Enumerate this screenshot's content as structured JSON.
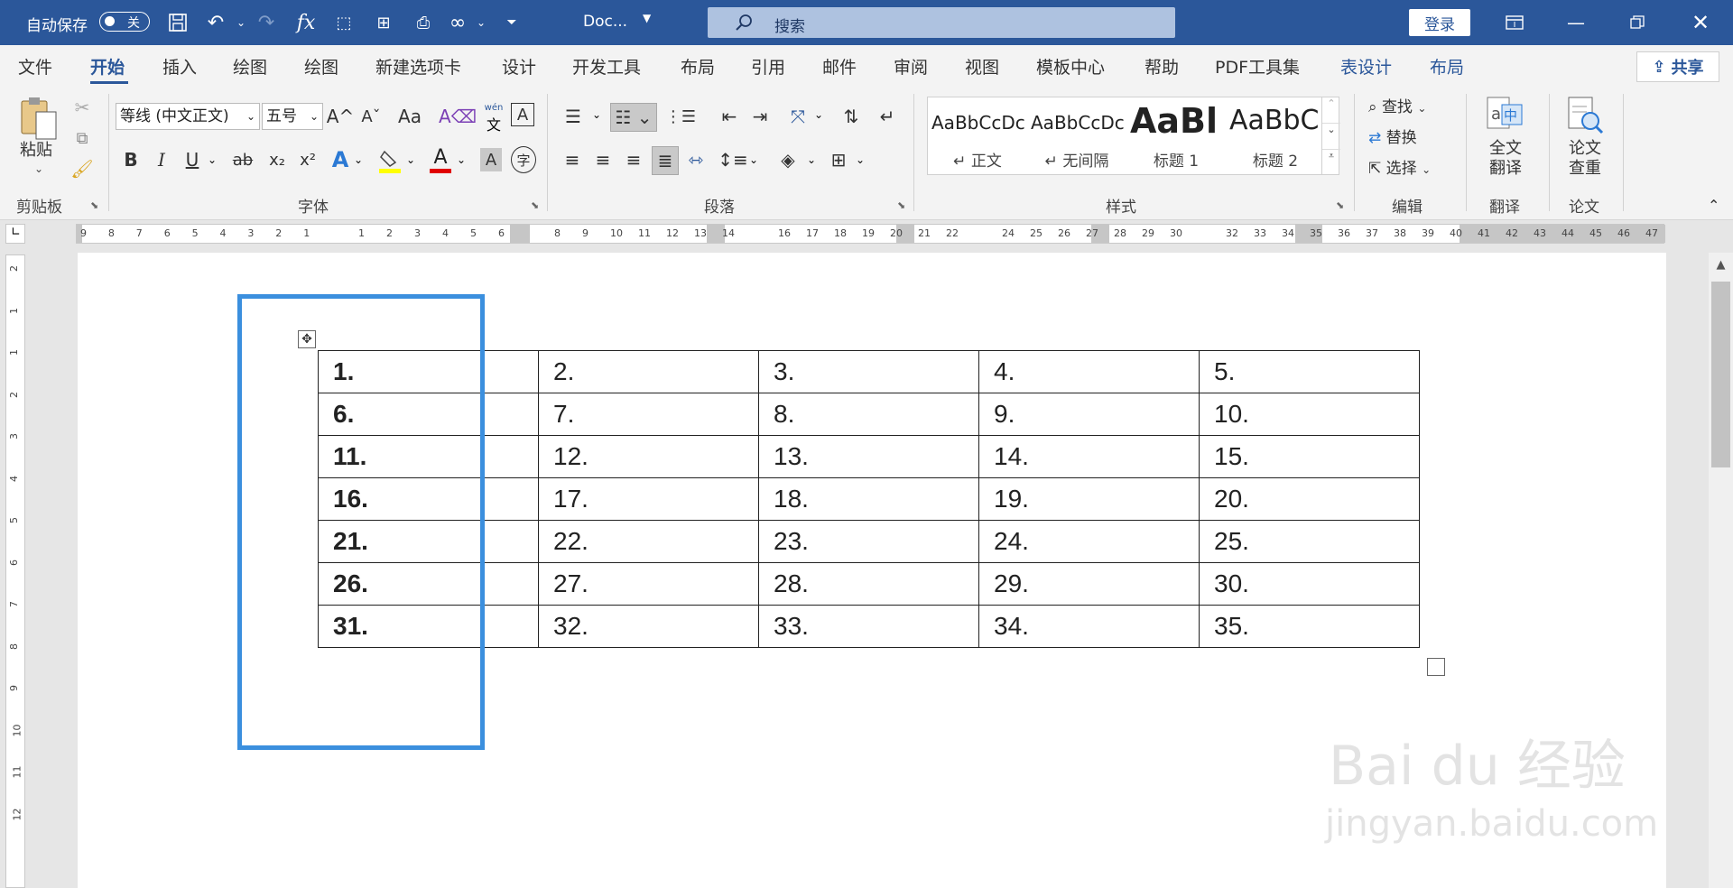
{
  "titlebar": {
    "autosave_label": "自动保存",
    "autosave_state": "关",
    "doc_name": "Doc...",
    "search_placeholder": "搜索",
    "login_label": "登录"
  },
  "menu": {
    "tabs": [
      "文件",
      "开始",
      "插入",
      "绘图",
      "绘图",
      "新建选项卡",
      "设计",
      "开发工具",
      "布局",
      "引用",
      "邮件",
      "审阅",
      "视图",
      "模板中心",
      "帮助",
      "PDF工具集",
      "表设计",
      "布局"
    ],
    "active_tab": "开始",
    "share_label": "共享"
  },
  "ribbon": {
    "clipboard": {
      "paste_label": "粘贴",
      "group_label": "剪贴板"
    },
    "font": {
      "font_name": "等线 (中文正文)",
      "font_size": "五号",
      "group_label": "字体",
      "grow": "A^",
      "shrink": "Aˇ",
      "case": "Aa",
      "bold": "B",
      "italic": "I",
      "underline": "U",
      "strike": "ab",
      "sub": "x₂",
      "sup": "x²",
      "pinyin_top": "wén",
      "pinyin_bottom": "文",
      "border_char": "A",
      "enclosed_char": "字"
    },
    "paragraph": {
      "group_label": "段落"
    },
    "styles": {
      "group_label": "样式",
      "items": [
        {
          "preview": "AaBbCcDc",
          "name": "↵ 正文"
        },
        {
          "preview": "AaBbCcDc",
          "name": "↵ 无间隔"
        },
        {
          "preview": "AaBl",
          "name": "标题 1"
        },
        {
          "preview": "AaBbC",
          "name": "标题 2"
        }
      ]
    },
    "editing": {
      "find": "查找",
      "replace": "替换",
      "select": "选择",
      "group_label": "编辑"
    },
    "translate": {
      "label_line1": "全文",
      "label_line2": "翻译",
      "group_label": "翻译"
    },
    "paper": {
      "label_line1": "论文",
      "label_line2": "查重",
      "group_label": "论文"
    }
  },
  "ruler": {
    "left_numbers": [
      "9",
      "8",
      "7",
      "6",
      "5",
      "4",
      "3",
      "2",
      "1"
    ],
    "right_numbers": [
      "1",
      "2",
      "3",
      "4",
      "5",
      "6",
      "8",
      "9",
      "10",
      "11",
      "12",
      "13",
      "14",
      "16",
      "17",
      "18",
      "19",
      "20",
      "21",
      "22",
      "24",
      "25",
      "26",
      "27",
      "28",
      "29",
      "30",
      "32",
      "33",
      "34",
      "35",
      "36",
      "37",
      "38",
      "39",
      "40",
      "41",
      "42",
      "43",
      "44",
      "45",
      "46",
      "47"
    ],
    "vertical_numbers": [
      "2",
      "1",
      "1",
      "2",
      "3",
      "4",
      "5",
      "6",
      "7",
      "8",
      "9",
      "10",
      "11",
      "12"
    ]
  },
  "table": {
    "rows": [
      [
        "1.",
        "2.",
        "3.",
        "4.",
        "5."
      ],
      [
        "6.",
        "7.",
        "8.",
        "9.",
        "10."
      ],
      [
        "11.",
        "12.",
        "13.",
        "14.",
        "15."
      ],
      [
        "16.",
        "17.",
        "18.",
        "19.",
        "20."
      ],
      [
        "21.",
        "22.",
        "23.",
        "24.",
        "25."
      ],
      [
        "26.",
        "27.",
        "28.",
        "29.",
        "30."
      ],
      [
        "31.",
        "32.",
        "33.",
        "34.",
        "35."
      ]
    ]
  },
  "watermark": {
    "brand": "Bai du 经验",
    "url": "jingyan.baidu.com"
  },
  "colors": {
    "word_blue": "#2b579a",
    "selection_blue": "#3b8fde"
  }
}
